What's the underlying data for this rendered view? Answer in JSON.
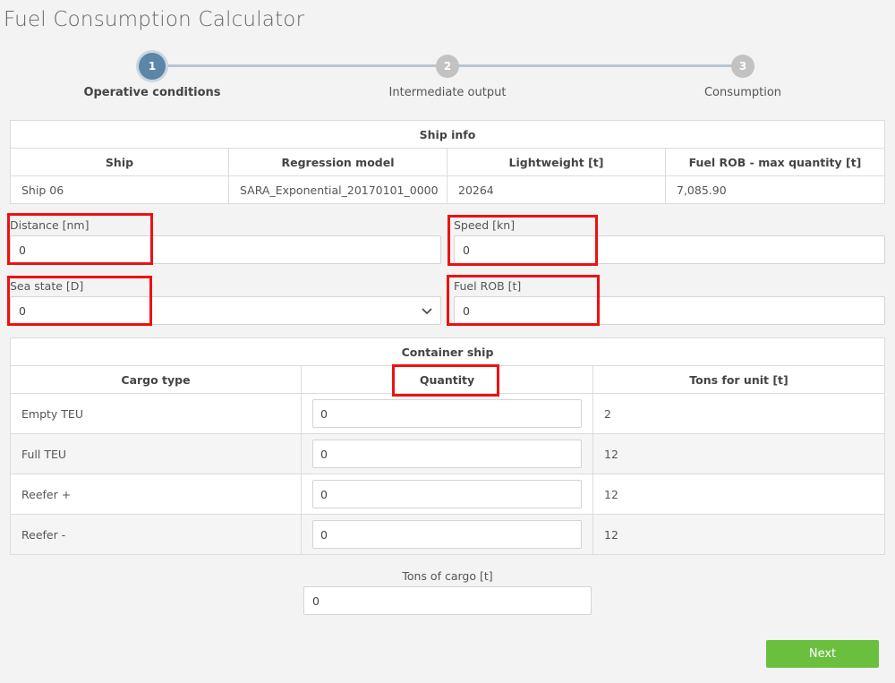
{
  "app": {
    "title": "Fuel Consumption Calculator"
  },
  "stepper": {
    "steps": [
      {
        "number": "1",
        "label": "Operative conditions",
        "active": true
      },
      {
        "number": "2",
        "label": "Intermediate output",
        "active": false
      },
      {
        "number": "3",
        "label": "Consumption",
        "active": false
      }
    ]
  },
  "ship_info": {
    "caption": "Ship info",
    "headers": [
      "Ship",
      "Regression model",
      "Lightweight [t]",
      "Fuel ROB - max quantity [t]"
    ],
    "row": [
      "Ship 06",
      "SARA_Exponential_20170101_0000",
      "20264",
      "7,085.90"
    ]
  },
  "fields": {
    "distance": {
      "label": "Distance [nm]",
      "value": "0"
    },
    "speed": {
      "label": "Speed [kn]",
      "value": "0"
    },
    "sea_state": {
      "label": "Sea state [D]",
      "value": "0"
    },
    "fuel_rob": {
      "label": "Fuel ROB [t]",
      "value": "0"
    }
  },
  "container": {
    "caption": "Container ship",
    "headers": [
      "Cargo type",
      "Quantity",
      "Tons for unit [t]"
    ],
    "rows": [
      {
        "type": "Empty TEU",
        "quantity": "0",
        "tons": "2"
      },
      {
        "type": "Full TEU",
        "quantity": "0",
        "tons": "12"
      },
      {
        "type": "Reefer +",
        "quantity": "0",
        "tons": "12"
      },
      {
        "type": "Reefer -",
        "quantity": "0",
        "tons": "12"
      }
    ]
  },
  "tons_of_cargo": {
    "label": "Tons of cargo [t]",
    "value": "0"
  },
  "buttons": {
    "next": "Next"
  },
  "colors": {
    "accent": "#5b86a8",
    "next": "#6bbf3f",
    "highlight": "#ee1111"
  },
  "icons": {
    "sea_state_select": "chevron-down-icon"
  }
}
